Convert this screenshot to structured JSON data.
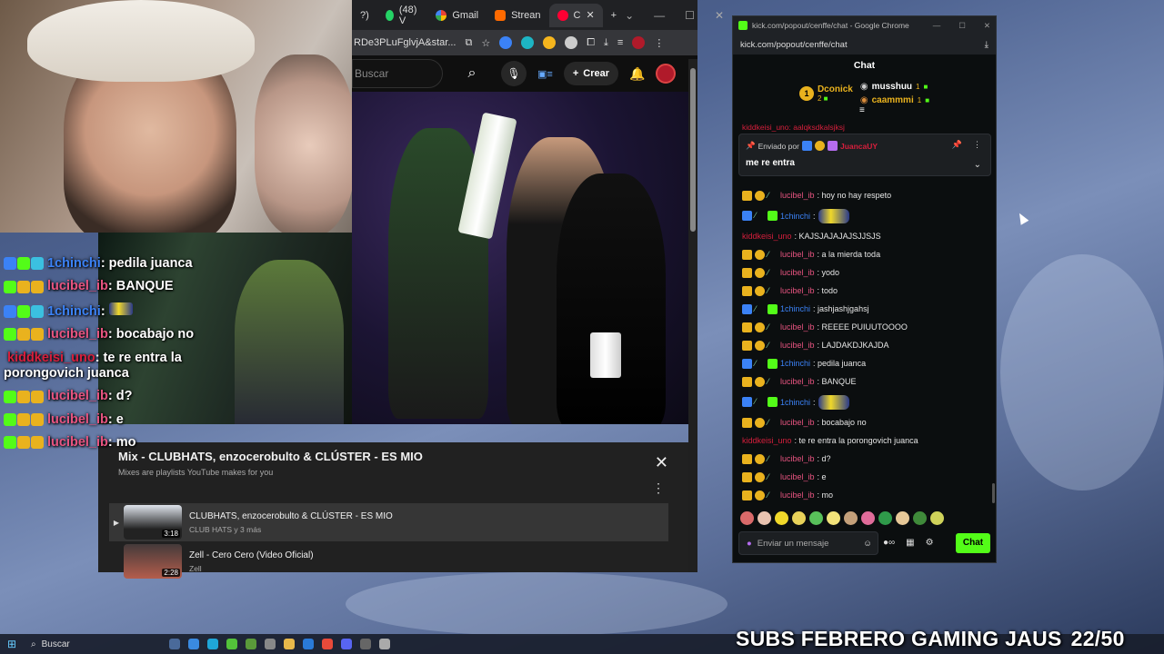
{
  "browser": {
    "tabs": [
      {
        "label": "(48) V",
        "icon": "whatsapp-icon",
        "color": "#25d366"
      },
      {
        "label": "Gmail",
        "icon": "google-icon",
        "color": "#ea4335"
      },
      {
        "label": "Strean",
        "icon": "streamlabs-icon",
        "color": "#ff6a00"
      },
      {
        "label": "C",
        "icon": "youtube-icon",
        "color": "#ff0033",
        "active": true
      }
    ],
    "tab_partial": "?)",
    "url": "RDe3PLuFglvjA&star..."
  },
  "youtube": {
    "search_placeholder": "Buscar",
    "create_label": "Crear"
  },
  "mix": {
    "title": "Mix - CLUBHATS, enzocerobulto & CLÚSTER - ES MIO",
    "subtitle": "Mixes are playlists YouTube makes for you",
    "items": [
      {
        "title": "CLUBHATS, enzocerobulto & CLÚSTER - ES MIO",
        "channel": "CLUB HATS y 3 más",
        "duration": "3:18"
      },
      {
        "title": "Zell - Cero Cero (Video Oficial)",
        "channel": "Zell",
        "duration": "2:28"
      }
    ]
  },
  "overlay_chat": [
    {
      "user": "1chinchi",
      "color": "#3b82f6",
      "text": ": pedila juanca"
    },
    {
      "user": "lucibel_ib",
      "color": "#e75480",
      "text": ": BANQUE"
    },
    {
      "user": "1chinchi",
      "color": "#3b82f6",
      "text": ":"
    },
    {
      "user": "lucibel_ib",
      "color": "#e75480",
      "text": ": bocabajo no"
    },
    {
      "user": "kiddkeisi_uno",
      "color": "#d61f3c",
      "text": ": te re entra la porongovich juanca"
    },
    {
      "user": "lucibel_ib",
      "color": "#e75480",
      "text": ": d?"
    },
    {
      "user": "lucibel_ib",
      "color": "#e75480",
      "text": ": e"
    },
    {
      "user": "lucibel_ib",
      "color": "#e75480",
      "text": ": mo"
    }
  ],
  "kick": {
    "window_title": "kick.com/popout/cenffe/chat - Google Chrome",
    "url": "kick.com/popout/cenffe/chat",
    "header": "Chat",
    "leaders": [
      {
        "rank": "1",
        "name": "Dconick",
        "count": "2",
        "color": "#e9b21e"
      },
      {
        "rank": "",
        "name": "musshuu",
        "count": "1",
        "color": "#e6e6e6"
      },
      {
        "rank": "",
        "name": "caammmi",
        "count": "1",
        "color": "#e9b21e"
      }
    ],
    "pinned": {
      "by_label": "Enviado por",
      "user": "JuancaUY",
      "message": "me re entra"
    },
    "partial_top": "kiddkeisi_uno: aalqksdkalsjksj",
    "messages": [
      {
        "user": "lucibel_ib",
        "color": "#e75480",
        "text": ": hoy no hay respeto",
        "badges": [
          "crown",
          "coin",
          "sword"
        ]
      },
      {
        "user": "1chinchi",
        "color": "#3b82f6",
        "text": ":",
        "badges": [
          "verified",
          "sword",
          "sub"
        ],
        "emote": true
      },
      {
        "user": "kiddkeisi_uno",
        "color": "#d61f3c",
        "text": ": KAJSJAJAJAJSJJSJS",
        "badges": []
      },
      {
        "user": "lucibel_ib",
        "color": "#e75480",
        "text": ": a la mierda toda",
        "badges": [
          "crown",
          "coin",
          "sword"
        ]
      },
      {
        "user": "lucibel_ib",
        "color": "#e75480",
        "text": ": yodo",
        "badges": [
          "crown",
          "coin",
          "sword"
        ]
      },
      {
        "user": "lucibel_ib",
        "color": "#e75480",
        "text": ": todo",
        "badges": [
          "crown",
          "coin",
          "sword"
        ]
      },
      {
        "user": "1chinchi",
        "color": "#3b82f6",
        "text": ": jashjashjgahsj",
        "badges": [
          "verified",
          "sword",
          "sub"
        ]
      },
      {
        "user": "lucibel_ib",
        "color": "#e75480",
        "text": ": REEEE PUIUUTOOOO",
        "badges": [
          "crown",
          "coin",
          "sword"
        ]
      },
      {
        "user": "lucibel_ib",
        "color": "#e75480",
        "text": ": LAJDAKDJKAJDA",
        "badges": [
          "crown",
          "coin",
          "sword"
        ]
      },
      {
        "user": "1chinchi",
        "color": "#3b82f6",
        "text": ": pedila juanca",
        "badges": [
          "verified",
          "sword",
          "sub"
        ]
      },
      {
        "user": "lucibel_ib",
        "color": "#e75480",
        "text": ": BANQUE",
        "badges": [
          "crown",
          "coin",
          "sword"
        ]
      },
      {
        "user": "1chinchi",
        "color": "#3b82f6",
        "text": ":",
        "badges": [
          "verified",
          "sword",
          "sub"
        ],
        "emote": true
      },
      {
        "user": "lucibel_ib",
        "color": "#e75480",
        "text": ": bocabajo no",
        "badges": [
          "crown",
          "coin",
          "sword"
        ]
      },
      {
        "user": "kiddkeisi_uno",
        "color": "#d61f3c",
        "text": ": te re entra la porongovich juanca",
        "badges": []
      },
      {
        "user": "lucibel_ib",
        "color": "#e75480",
        "text": ": d?",
        "badges": [
          "crown",
          "coin",
          "sword"
        ]
      },
      {
        "user": "lucibel_ib",
        "color": "#e75480",
        "text": ": e",
        "badges": [
          "crown",
          "coin",
          "sword"
        ]
      },
      {
        "user": "lucibel_ib",
        "color": "#e75480",
        "text": ": mo",
        "badges": [
          "crown",
          "coin",
          "sword"
        ]
      }
    ],
    "input_placeholder": "Enviar un mensaje",
    "send_label": "Chat",
    "accent": "#53fc18"
  },
  "taskbar": {
    "search_label": "Buscar"
  },
  "overlay_goal": {
    "text": "SUBS FEBRERO GAMING JAUS",
    "count": "22/50"
  }
}
